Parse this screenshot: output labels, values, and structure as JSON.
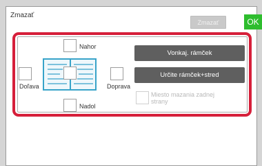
{
  "header": {
    "title": "Zmazať",
    "erase_button_label": "Zmazať",
    "ok_button_label": "OK"
  },
  "options": {
    "top_label": "Nahor",
    "left_label": "Doľava",
    "right_label": "Doprava",
    "bottom_label": "Nadol",
    "outer_frame_label": "Vonkaj. rámček",
    "frame_center_label": "Určite rámček+stred",
    "back_side_label": "Miesto mazania zadnej strany"
  },
  "colors": {
    "accent_ok": "#2ebd2e",
    "highlight": "#d61f3a",
    "book_blue": "#37a3c9",
    "button_dark": "#5f5f5f"
  }
}
